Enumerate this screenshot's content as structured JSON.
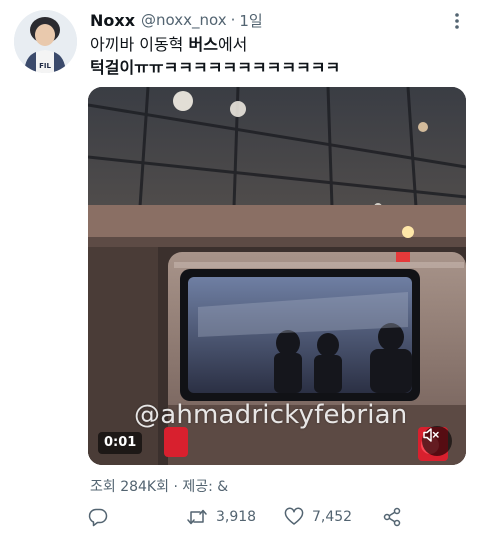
{
  "tweet": {
    "author_name": "Noxx",
    "handle": "@noxx_nox",
    "separator": "·",
    "time": "1일",
    "text_line1_normal": "아끼바 이동혁 ",
    "text_line1_bold": "버스",
    "text_line1_tail": "에서",
    "text_line2_bold": "턱걸이",
    "text_line2_tail": "ㅠㅠㅋㅋㅋㅋㅋㅋㅋㅋㅋㅋㅋㅋ",
    "avatar_shirt_text": "FIL"
  },
  "media": {
    "watermark": "@ahmadrickyfebrian",
    "timecode": "0:01"
  },
  "views": "조회 284K회 · 제공: &",
  "actions": {
    "reply_count": "",
    "retweet_count": "3,918",
    "like_count": "7,452"
  },
  "icons": {
    "more": "more-icon",
    "reply": "reply-icon",
    "retweet": "retweet-icon",
    "like": "like-icon",
    "share": "share-icon",
    "mute": "mute-icon"
  },
  "colors": {
    "text": "#0f1419",
    "secondary": "#536471"
  }
}
